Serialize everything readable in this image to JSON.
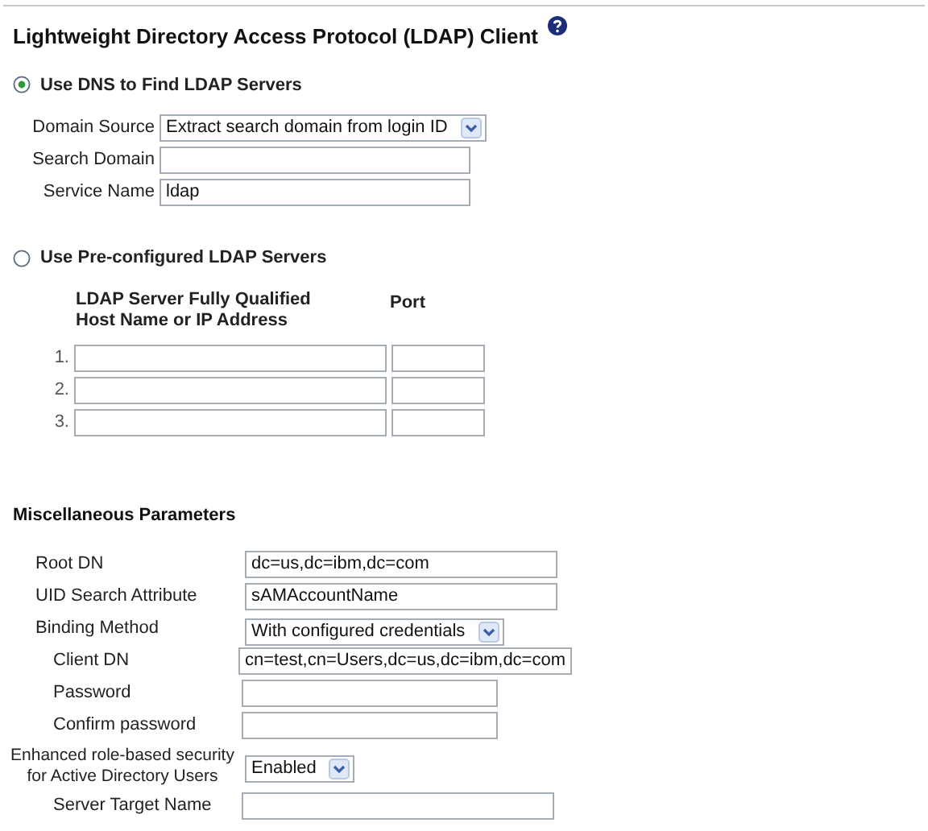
{
  "title": "Lightweight Directory Access Protocol (LDAP) Client",
  "dns": {
    "label": "Use DNS to Find LDAP Servers",
    "selected": true,
    "fields": [
      {
        "label": "Domain Source",
        "kind": "select",
        "value": "Extract search domain from login ID"
      },
      {
        "label": "Search Domain",
        "kind": "text"
      },
      {
        "label": "Service Name",
        "kind": "text",
        "value": "ldap"
      }
    ]
  },
  "preconfigured": {
    "label": "Use Pre-configured LDAP Servers",
    "selected": false,
    "columns": [
      "LDAP Server Fully Qualified Host Name or IP Address",
      "Port"
    ],
    "rows": [
      {
        "number": "1."
      },
      {
        "number": "2."
      },
      {
        "number": "3."
      }
    ]
  },
  "misc": {
    "title": "Miscellaneous Parameters",
    "params": [
      {
        "label": "Root DN",
        "kind": "text",
        "value": "dc=us,dc=ibm,dc=com"
      },
      {
        "label": "UID Search Attribute",
        "kind": "text",
        "value": "sAMAccountName"
      },
      {
        "label": "Binding Method",
        "kind": "select",
        "value": "With configured credentials",
        "children": [
          {
            "label": "Client DN",
            "kind": "text",
            "value": "cn=test,cn=Users,dc=us,dc=ibm,dc=com"
          },
          {
            "label": "Password",
            "kind": "password"
          },
          {
            "label": "Confirm password",
            "kind": "password"
          }
        ]
      },
      {
        "label": "Enhanced role-based security for Active Directory Users",
        "kind": "select",
        "value": "Enabled",
        "centered": true,
        "children": [
          {
            "label": "Server Target Name",
            "kind": "text"
          }
        ]
      }
    ]
  }
}
